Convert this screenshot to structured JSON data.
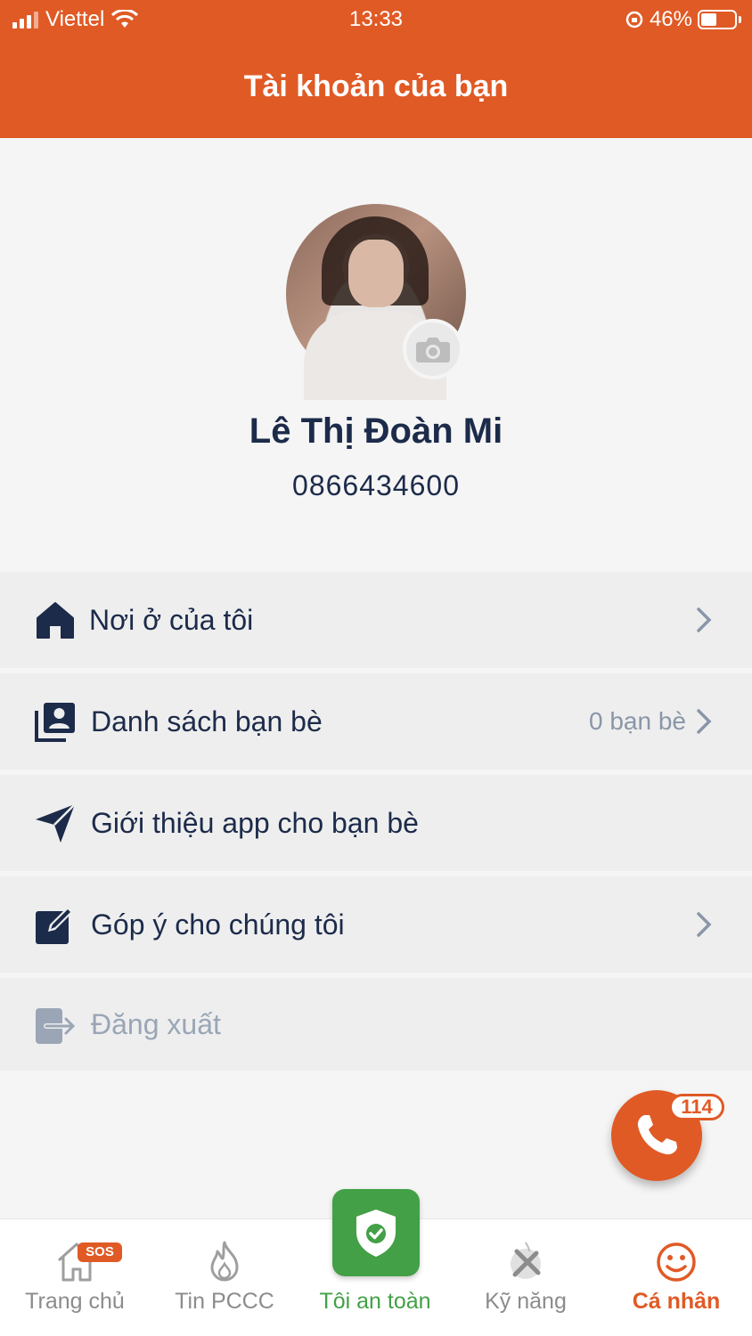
{
  "status_bar": {
    "carrier": "Viettel",
    "time": "13:33",
    "battery": "46%",
    "battery_level": 0.46
  },
  "header": {
    "title": "Tài khoản của bạn"
  },
  "profile": {
    "name": "Lê Thị Đoàn Mi",
    "phone": "0866434600"
  },
  "menu": [
    {
      "label": "Nơi ở của tôi",
      "icon": "home-icon",
      "value": ""
    },
    {
      "label": "Danh sách bạn bè",
      "icon": "contacts-icon",
      "value": "0 bạn bè"
    },
    {
      "label": "Giới thiệu app cho bạn bè",
      "icon": "send-icon",
      "value": ""
    },
    {
      "label": "Góp ý cho chúng tôi",
      "icon": "edit-icon",
      "value": ""
    },
    {
      "label": "Đăng xuất",
      "icon": "logout-icon",
      "value": ""
    }
  ],
  "call_button": {
    "badge": "114"
  },
  "bottom_nav": {
    "items": [
      {
        "label": "Trang chủ",
        "badge": "SOS",
        "icon": "home-outline-icon"
      },
      {
        "label": "Tin PCCC",
        "icon": "fire-icon"
      },
      {
        "label": "Tôi an toàn",
        "icon": "shield-check-icon"
      },
      {
        "label": "Kỹ năng",
        "icon": "tools-icon"
      },
      {
        "label": "Cá nhân",
        "icon": "smiley-icon"
      }
    ],
    "active": "Cá nhân"
  },
  "colors": {
    "brand": "#e05a25",
    "navy": "#1c2b4a",
    "green": "#43a047",
    "muted": "#8c8c8c"
  }
}
